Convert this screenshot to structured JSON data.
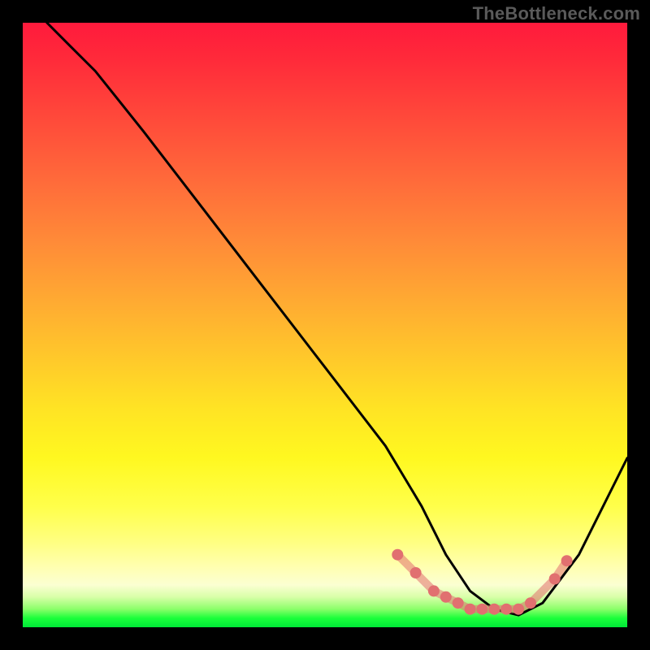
{
  "watermark": "TheBottleneck.com",
  "chart_data": {
    "type": "line",
    "title": "",
    "xlabel": "",
    "ylabel": "",
    "xlim": [
      0,
      100
    ],
    "ylim": [
      0,
      100
    ],
    "series": [
      {
        "name": "black-curve",
        "color": "#000000",
        "x": [
          4,
          8,
          12,
          20,
          30,
          40,
          50,
          60,
          66,
          70,
          74,
          78,
          82,
          86,
          92,
          100
        ],
        "values": [
          100,
          96,
          92,
          82,
          69,
          56,
          43,
          30,
          20,
          12,
          6,
          3,
          2,
          4,
          12,
          28
        ]
      },
      {
        "name": "salmon-dots",
        "color": "#e17070",
        "x": [
          62,
          65,
          68,
          70,
          72,
          74,
          76,
          78,
          80,
          82,
          84,
          88,
          90
        ],
        "values": [
          12,
          9,
          6,
          5,
          4,
          3,
          3,
          3,
          3,
          3,
          4,
          8,
          11
        ]
      }
    ]
  }
}
